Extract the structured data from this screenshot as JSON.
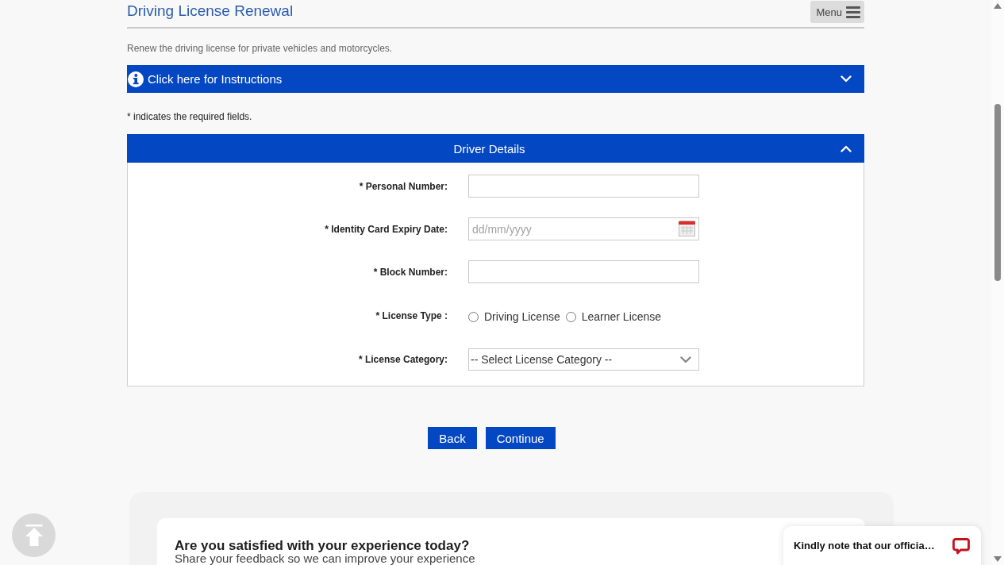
{
  "header": {
    "title": "Driving License Renewal",
    "menu_button": {
      "label": "Menu"
    }
  },
  "description": "Renew the driving license for private vehicles and motorcycles.",
  "instructions": {
    "label": "Click here for Instructions",
    "expanded": false
  },
  "required_note": "* indicates the required fields.",
  "driver_details": {
    "title": "Driver Details",
    "expanded": true,
    "fields": [
      {
        "kind": "text",
        "label": "* Personal Number:"
      },
      {
        "kind": "date",
        "label": "* Identity Card Expiry Date:",
        "placeholder": "dd/mm/yyyy"
      },
      {
        "kind": "text",
        "label": "* Block Number:"
      },
      {
        "kind": "radio",
        "label": "* License Type :",
        "options": [
          {
            "label": "Driving License",
            "selected": false
          },
          {
            "label": "Learner License",
            "selected": false
          }
        ]
      },
      {
        "kind": "select",
        "label": "* License Category:",
        "value": "-- Select License Category --"
      }
    ]
  },
  "buttons": [
    {
      "label": "Back"
    },
    {
      "label": "Continue"
    }
  ],
  "feedback": {
    "title": "Are you satisfied with your experience today?",
    "subtitle": "Share your feedback so we can improve your experience"
  },
  "chat_widget": {
    "message": "Kindly note that our officia…"
  }
}
